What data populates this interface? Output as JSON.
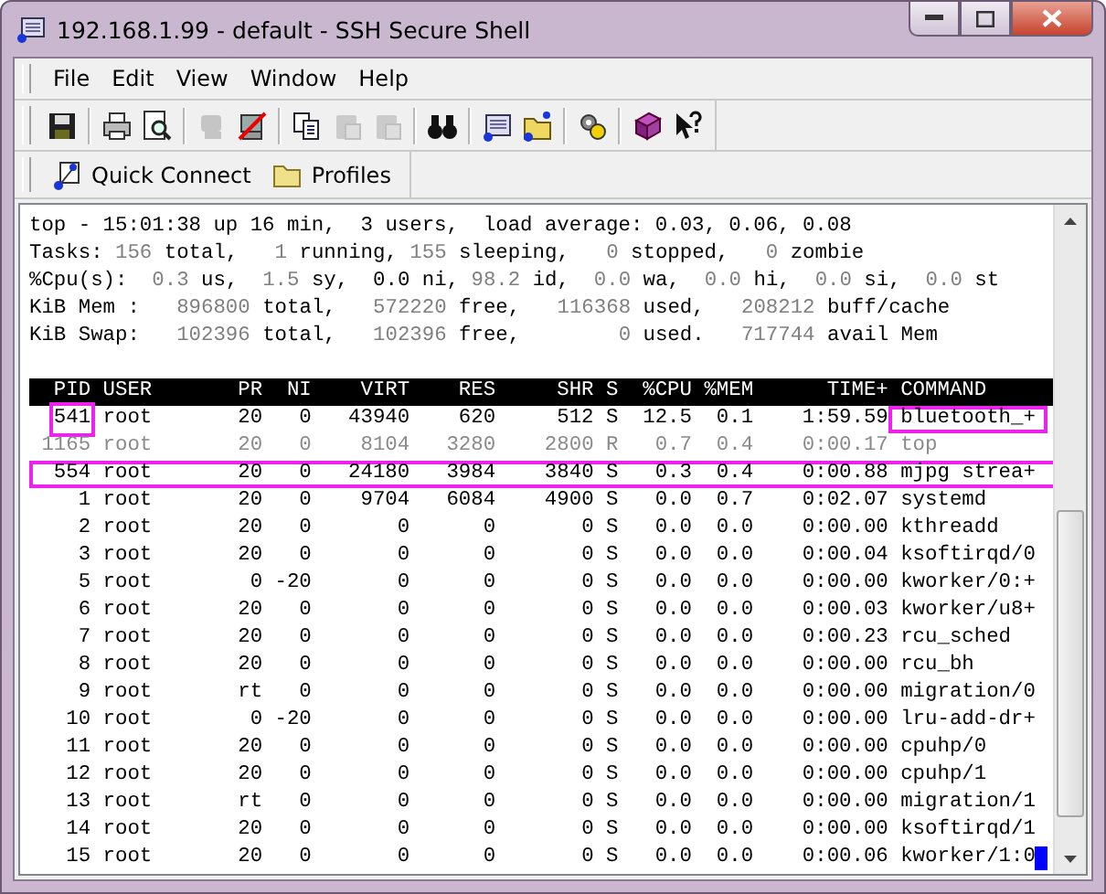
{
  "window": {
    "title": "192.168.1.99 - default - SSH Secure Shell"
  },
  "menu": [
    "File",
    "Edit",
    "View",
    "Window",
    "Help"
  ],
  "toolbar": [
    {
      "kind": "save",
      "disabled": false
    },
    {
      "kind": "separator"
    },
    {
      "kind": "print",
      "disabled": false
    },
    {
      "kind": "preview",
      "disabled": false
    },
    {
      "kind": "separator"
    },
    {
      "kind": "connect",
      "disabled": true
    },
    {
      "kind": "disconnect",
      "disabled": false
    },
    {
      "kind": "separator"
    },
    {
      "kind": "copy",
      "disabled": false
    },
    {
      "kind": "paste",
      "disabled": true
    },
    {
      "kind": "paste",
      "disabled": true
    },
    {
      "kind": "separator"
    },
    {
      "kind": "find",
      "disabled": false
    },
    {
      "kind": "separator"
    },
    {
      "kind": "terminal",
      "disabled": false
    },
    {
      "kind": "filetransfer",
      "disabled": false
    },
    {
      "kind": "separator"
    },
    {
      "kind": "settings",
      "disabled": false
    },
    {
      "kind": "separator"
    },
    {
      "kind": "help",
      "disabled": false
    },
    {
      "kind": "whatsthis",
      "disabled": false
    }
  ],
  "quickbar": [
    {
      "kind": "connect",
      "label": "Quick Connect"
    },
    {
      "kind": "folder",
      "label": "Profiles"
    }
  ],
  "summary": [
    [
      {
        "t": "top - 15:01:38 up 16 min,  3 users,  load average: 0.03, 0.06, 0.08",
        "dim": false
      }
    ],
    [
      {
        "t": "Tasks: ",
        "dim": false
      },
      {
        "t": "156",
        "dim": true
      },
      {
        "t": " total,   ",
        "dim": false
      },
      {
        "t": "1",
        "dim": true
      },
      {
        "t": " running, ",
        "dim": false
      },
      {
        "t": "155",
        "dim": true
      },
      {
        "t": " sleeping,   ",
        "dim": false
      },
      {
        "t": "0",
        "dim": true
      },
      {
        "t": " stopped,   ",
        "dim": false
      },
      {
        "t": "0",
        "dim": true
      },
      {
        "t": " zombie",
        "dim": false
      }
    ],
    [
      {
        "t": "%Cpu(s):  ",
        "dim": false
      },
      {
        "t": "0.3",
        "dim": true
      },
      {
        "t": " us,  ",
        "dim": false
      },
      {
        "t": "1.5",
        "dim": true
      },
      {
        "t": " sy,  0.0 ni, ",
        "dim": false
      },
      {
        "t": "98.2",
        "dim": true
      },
      {
        "t": " id,  ",
        "dim": false
      },
      {
        "t": "0.0",
        "dim": true
      },
      {
        "t": " wa,  ",
        "dim": false
      },
      {
        "t": "0.0",
        "dim": true
      },
      {
        "t": " hi,  ",
        "dim": false
      },
      {
        "t": "0.0",
        "dim": true
      },
      {
        "t": " si,  ",
        "dim": false
      },
      {
        "t": "0.0",
        "dim": true
      },
      {
        "t": " st",
        "dim": false
      }
    ],
    [
      {
        "t": "KiB Mem :   ",
        "dim": false
      },
      {
        "t": "896800",
        "dim": true
      },
      {
        "t": " total,   ",
        "dim": false
      },
      {
        "t": "572220",
        "dim": true
      },
      {
        "t": " free,   ",
        "dim": false
      },
      {
        "t": "116368",
        "dim": true
      },
      {
        "t": " used,   ",
        "dim": false
      },
      {
        "t": "208212",
        "dim": true
      },
      {
        "t": " buff/cache",
        "dim": false
      }
    ],
    [
      {
        "t": "KiB Swap:   ",
        "dim": false
      },
      {
        "t": "102396",
        "dim": true
      },
      {
        "t": " total,   ",
        "dim": false
      },
      {
        "t": "102396",
        "dim": true
      },
      {
        "t": " free,        ",
        "dim": false
      },
      {
        "t": "0",
        "dim": true
      },
      {
        "t": " used.   ",
        "dim": false
      },
      {
        "t": "717744",
        "dim": true
      },
      {
        "t": " avail Mem",
        "dim": false
      }
    ]
  ],
  "columns": [
    "PID",
    "USER",
    "PR",
    "NI",
    "VIRT",
    "RES",
    "SHR",
    "S",
    "%CPU",
    "%MEM",
    "TIME+",
    "COMMAND"
  ],
  "rows": [
    {
      "cells": [
        "541",
        "root",
        "20",
        "0",
        "43940",
        "620",
        "512",
        "S",
        "12.5",
        "0.1",
        "1:59.59",
        "bluetooth_+"
      ],
      "dimmed": false,
      "boxed": false,
      "pid_boxed": true,
      "command_boxed": true
    },
    {
      "cells": [
        "1165",
        "root",
        "20",
        "0",
        "8104",
        "3280",
        "2800",
        "R",
        "0.7",
        "0.4",
        "0:00.17",
        "top"
      ],
      "dimmed": true,
      "boxed": false,
      "pid_boxed": false,
      "command_boxed": false
    },
    {
      "cells": [
        "554",
        "root",
        "20",
        "0",
        "24180",
        "3984",
        "3840",
        "S",
        "0.3",
        "0.4",
        "0:00.88",
        "mjpg strea+"
      ],
      "dimmed": false,
      "boxed": true,
      "pid_boxed": false,
      "command_boxed": false
    },
    {
      "cells": [
        "1",
        "root",
        "20",
        "0",
        "9704",
        "6084",
        "4900",
        "S",
        "0.0",
        "0.7",
        "0:02.07",
        "systemd"
      ],
      "dimmed": false,
      "boxed": false,
      "pid_boxed": false,
      "command_boxed": false
    },
    {
      "cells": [
        "2",
        "root",
        "20",
        "0",
        "0",
        "0",
        "0",
        "S",
        "0.0",
        "0.0",
        "0:00.00",
        "kthreadd"
      ],
      "dimmed": false,
      "boxed": false,
      "pid_boxed": false,
      "command_boxed": false
    },
    {
      "cells": [
        "3",
        "root",
        "20",
        "0",
        "0",
        "0",
        "0",
        "S",
        "0.0",
        "0.0",
        "0:00.04",
        "ksoftirqd/0"
      ],
      "dimmed": false,
      "boxed": false,
      "pid_boxed": false,
      "command_boxed": false
    },
    {
      "cells": [
        "5",
        "root",
        "0",
        "-20",
        "0",
        "0",
        "0",
        "S",
        "0.0",
        "0.0",
        "0:00.00",
        "kworker/0:+"
      ],
      "dimmed": false,
      "boxed": false,
      "pid_boxed": false,
      "command_boxed": false
    },
    {
      "cells": [
        "6",
        "root",
        "20",
        "0",
        "0",
        "0",
        "0",
        "S",
        "0.0",
        "0.0",
        "0:00.03",
        "kworker/u8+"
      ],
      "dimmed": false,
      "boxed": false,
      "pid_boxed": false,
      "command_boxed": false
    },
    {
      "cells": [
        "7",
        "root",
        "20",
        "0",
        "0",
        "0",
        "0",
        "S",
        "0.0",
        "0.0",
        "0:00.23",
        "rcu_sched"
      ],
      "dimmed": false,
      "boxed": false,
      "pid_boxed": false,
      "command_boxed": false
    },
    {
      "cells": [
        "8",
        "root",
        "20",
        "0",
        "0",
        "0",
        "0",
        "S",
        "0.0",
        "0.0",
        "0:00.00",
        "rcu_bh"
      ],
      "dimmed": false,
      "boxed": false,
      "pid_boxed": false,
      "command_boxed": false
    },
    {
      "cells": [
        "9",
        "root",
        "rt",
        "0",
        "0",
        "0",
        "0",
        "S",
        "0.0",
        "0.0",
        "0:00.00",
        "migration/0"
      ],
      "dimmed": false,
      "boxed": false,
      "pid_boxed": false,
      "command_boxed": false
    },
    {
      "cells": [
        "10",
        "root",
        "0",
        "-20",
        "0",
        "0",
        "0",
        "S",
        "0.0",
        "0.0",
        "0:00.00",
        "lru-add-dr+"
      ],
      "dimmed": false,
      "boxed": false,
      "pid_boxed": false,
      "command_boxed": false
    },
    {
      "cells": [
        "11",
        "root",
        "20",
        "0",
        "0",
        "0",
        "0",
        "S",
        "0.0",
        "0.0",
        "0:00.00",
        "cpuhp/0"
      ],
      "dimmed": false,
      "boxed": false,
      "pid_boxed": false,
      "command_boxed": false
    },
    {
      "cells": [
        "12",
        "root",
        "20",
        "0",
        "0",
        "0",
        "0",
        "S",
        "0.0",
        "0.0",
        "0:00.00",
        "cpuhp/1"
      ],
      "dimmed": false,
      "boxed": false,
      "pid_boxed": false,
      "command_boxed": false
    },
    {
      "cells": [
        "13",
        "root",
        "rt",
        "0",
        "0",
        "0",
        "0",
        "S",
        "0.0",
        "0.0",
        "0:00.00",
        "migration/1"
      ],
      "dimmed": false,
      "boxed": false,
      "pid_boxed": false,
      "command_boxed": false
    },
    {
      "cells": [
        "14",
        "root",
        "20",
        "0",
        "0",
        "0",
        "0",
        "S",
        "0.0",
        "0.0",
        "0:00.00",
        "ksoftirqd/1"
      ],
      "dimmed": false,
      "boxed": false,
      "pid_boxed": false,
      "command_boxed": false
    },
    {
      "cells": [
        "15",
        "root",
        "20",
        "0",
        "0",
        "0",
        "0",
        "S",
        "0.0",
        "0.0",
        "0:00.06",
        "kworker/1:0"
      ],
      "dimmed": false,
      "boxed": false,
      "pid_boxed": false,
      "command_boxed": false
    }
  ],
  "cursor": {
    "on": true
  }
}
